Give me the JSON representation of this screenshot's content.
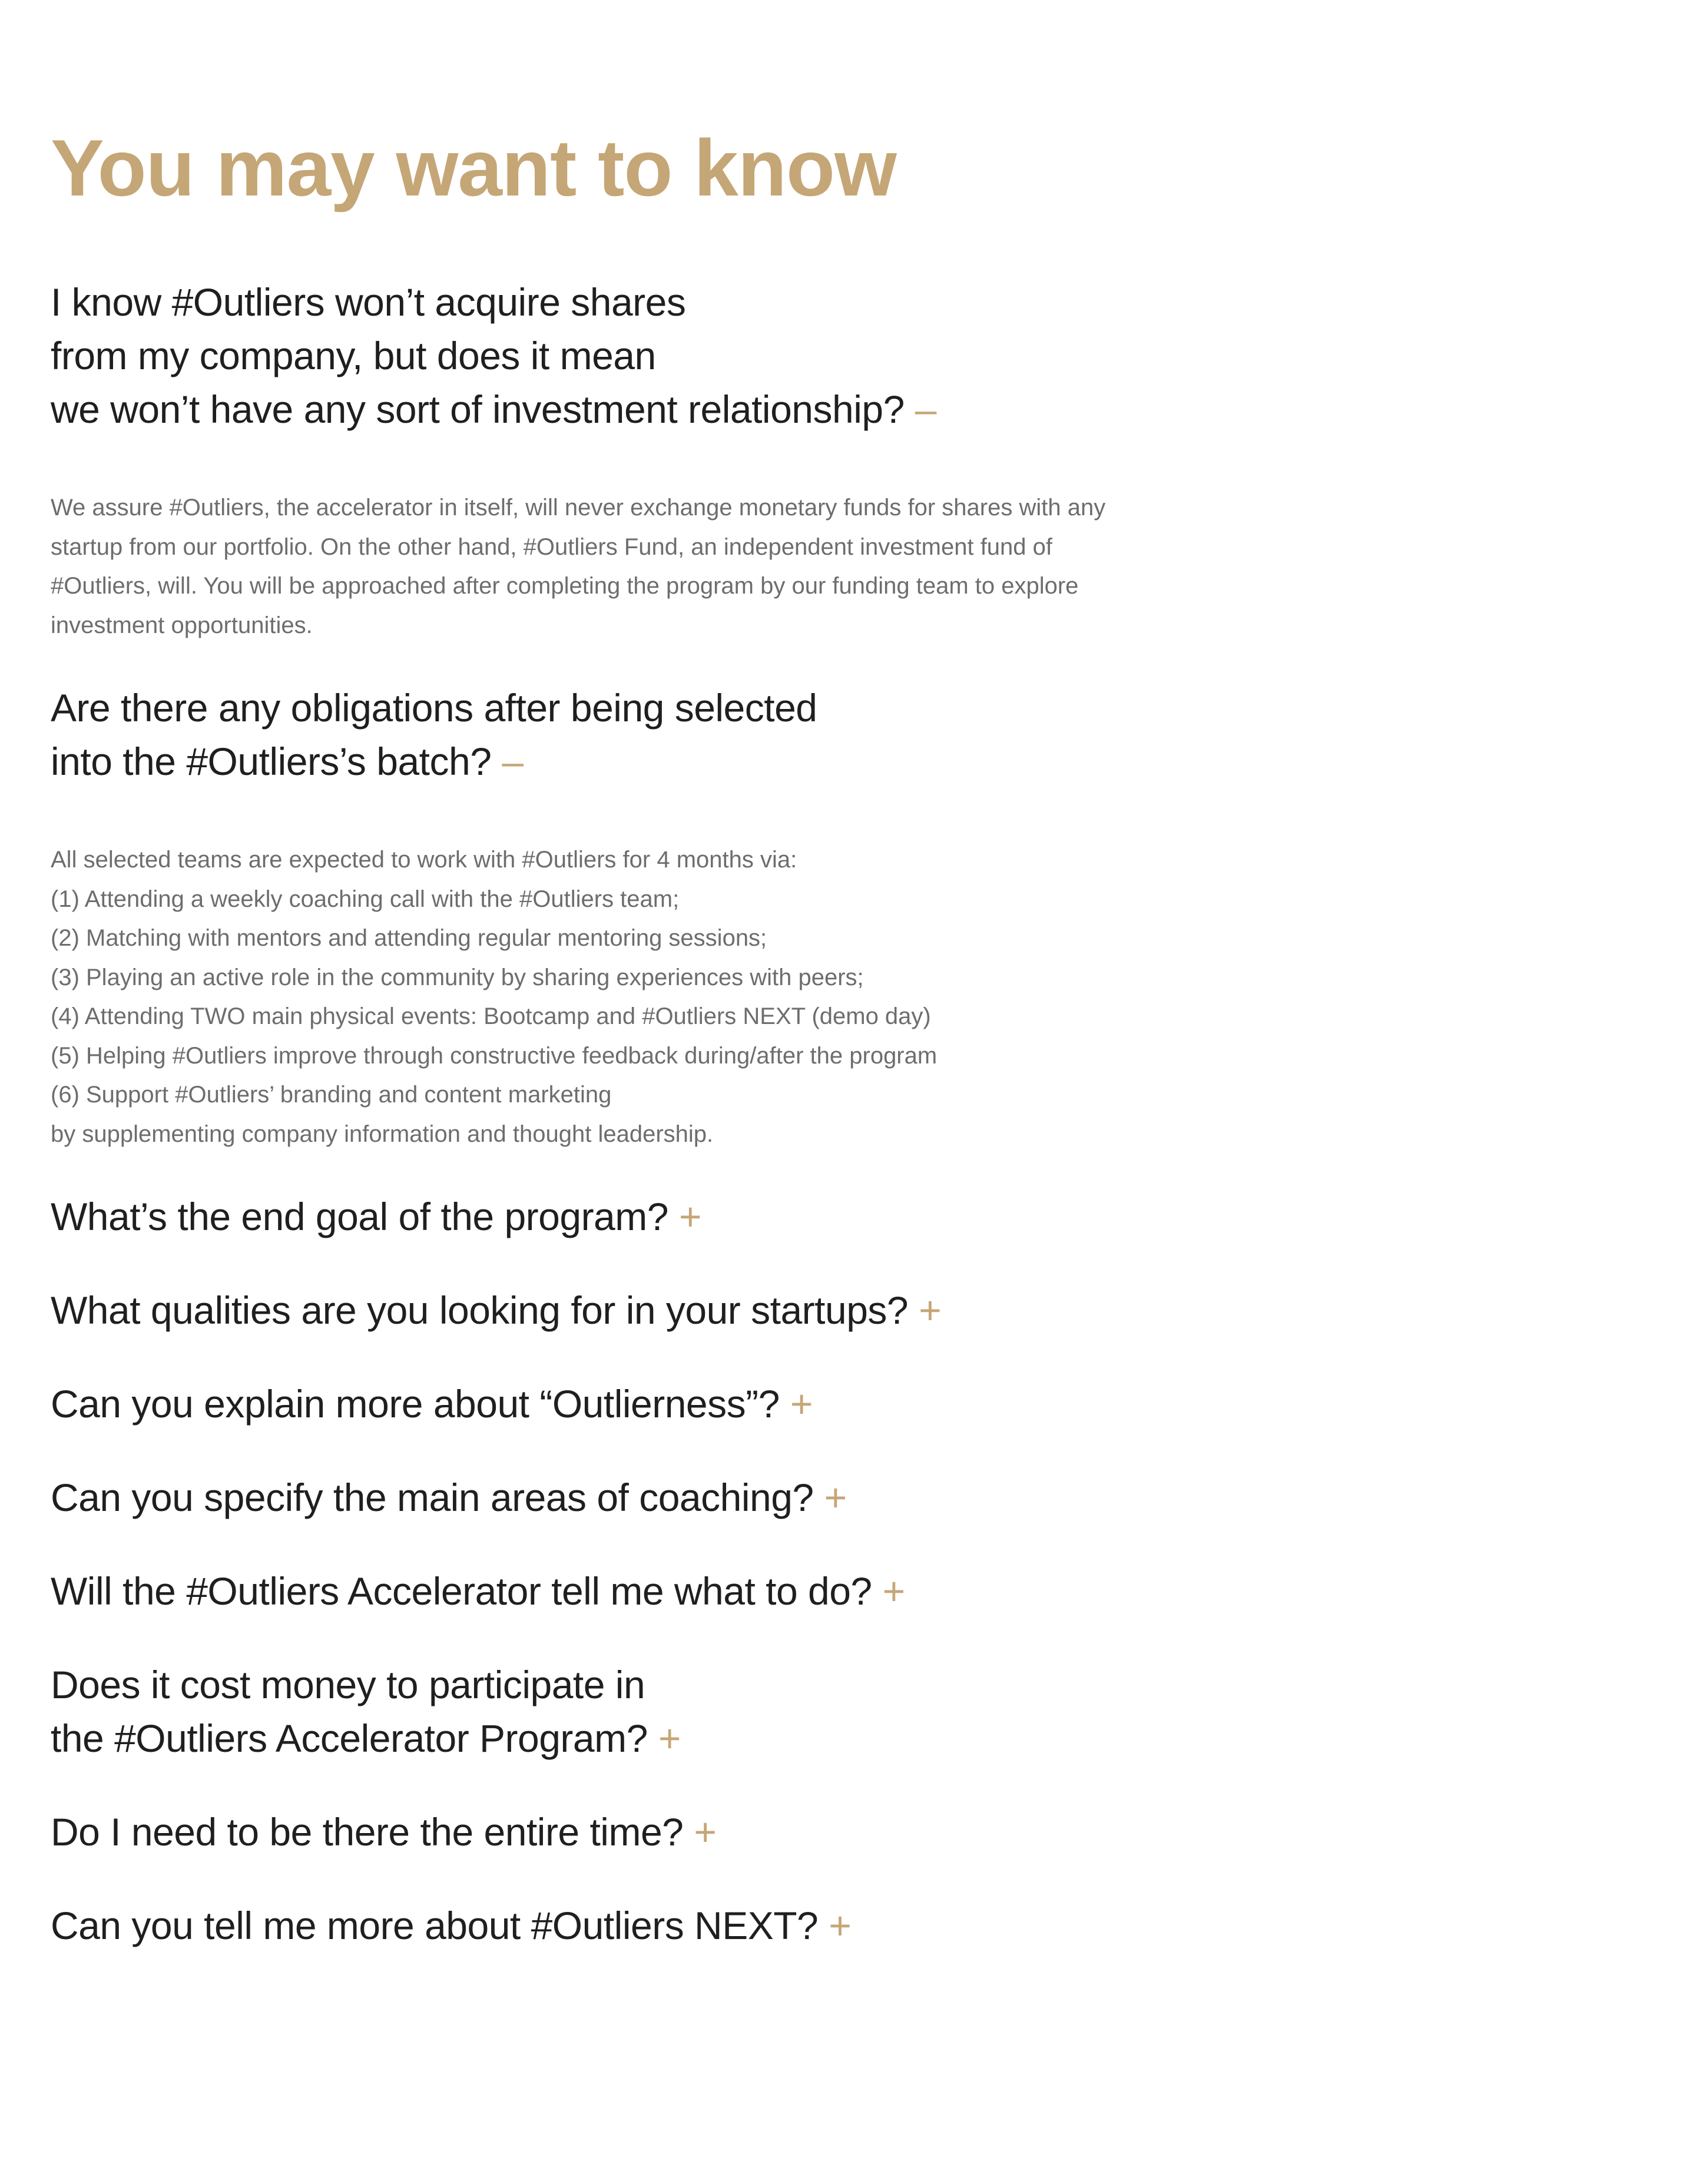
{
  "header": {
    "title": "You may want to know"
  },
  "colors": {
    "accent": "#c5a676",
    "question_text": "#1f1f1f",
    "answer_text": "#6d6d6d"
  },
  "toggle_icons": {
    "expanded": "–",
    "collapsed": "+"
  },
  "faq": [
    {
      "question_lines": [
        "I know #Outliers won’t acquire shares",
        "from my company, but does it mean",
        "we won’t have any sort of investment relationship?"
      ],
      "expanded": true,
      "answer_lines": [
        "We assure #Outliers, the accelerator in itself, will never exchange monetary funds for shares with any",
        "startup from our portfolio. On the other hand, #Outliers Fund, an independent investment fund of",
        "#Outliers, will. You will be approached after completing the program by our funding team to explore",
        "investment opportunities."
      ]
    },
    {
      "question_lines": [
        "Are there any obligations after being selected",
        "into the #Outliers’s batch?"
      ],
      "expanded": true,
      "answer_lines": [
        "All selected teams are expected to work with #Outliers for 4 months via:",
        "(1) Attending a weekly coaching call with the #Outliers team;",
        "(2) Matching with mentors and attending regular mentoring sessions;",
        "(3) Playing an active role in the community by sharing experiences with peers;",
        "(4) Attending TWO main physical events: Bootcamp and #Outliers NEXT (demo day)",
        "(5) Helping #Outliers improve through constructive feedback during/after the program",
        "(6) Support #Outliers’ branding and content marketing",
        " by supplementing company information and thought leadership."
      ]
    },
    {
      "question_lines": [
        "What’s the end goal of the program?"
      ],
      "expanded": false
    },
    {
      "question_lines": [
        "What qualities are you looking for in your startups?"
      ],
      "expanded": false
    },
    {
      "question_lines": [
        "Can you explain more about “Outlierness”?"
      ],
      "expanded": false
    },
    {
      "question_lines": [
        "Can you specify the main areas of coaching?"
      ],
      "expanded": false
    },
    {
      "question_lines": [
        "Will the #Outliers Accelerator tell me what to do?"
      ],
      "expanded": false
    },
    {
      "question_lines": [
        "Does it cost money to participate in",
        "the #Outliers Accelerator Program?"
      ],
      "expanded": false
    },
    {
      "question_lines": [
        "Do I need to be there the entire time?"
      ],
      "expanded": false
    },
    {
      "question_lines": [
        "Can you tell me more about #Outliers NEXT?"
      ],
      "expanded": false
    }
  ]
}
